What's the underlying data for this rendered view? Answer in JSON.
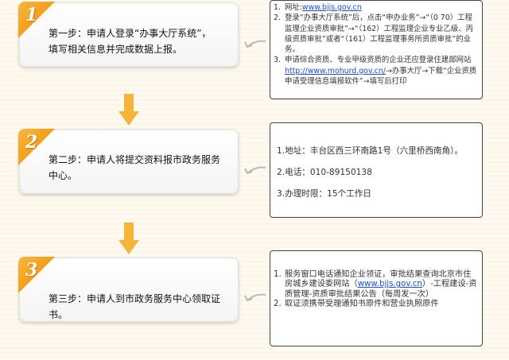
{
  "steps": [
    {
      "num": "1",
      "line1": "第一步：申请人登录“办事大厅系统”，",
      "line2": "填写相关信息并完成数据上报。"
    },
    {
      "num": "2",
      "line1": "第二步：申请人将提交资料报市政务服务",
      "line2": "中心。"
    },
    {
      "num": "3",
      "line1": "第三步：申请人到市政务服务中心领取证书。",
      "line2": ""
    }
  ],
  "info1": {
    "items": [
      {
        "n": "1.",
        "pre": "网址:",
        "link": "www.bjjs.gov.cn",
        "post": ""
      },
      {
        "n": "2.",
        "pre": "登录“办事大厅系统”后，点击“申办业务”→“（0 70）工程监理企业资质审批”→“（162）工程监理企业专业乙级、丙级资质审批”或者“（161）工程监理事务所资质审批”的业务。",
        "link": "",
        "post": ""
      },
      {
        "n": "3.",
        "pre": "申请综合资质、专业甲级资质的企业还应登录住建部网站",
        "link": "http://www.mohurd.gov.cn/",
        "post": "→办事大厅→下载“企业资质申请受理信息填报软件”→填写后打印"
      }
    ]
  },
  "info2": {
    "items": [
      {
        "n": "1.",
        "text": "地址：丰台区西三环南路1号（六里桥西南角）。"
      },
      {
        "n": "2.",
        "text": "电话：010-89150138"
      },
      {
        "n": "3.",
        "text": "办理时限：15个工作日"
      }
    ]
  },
  "info3": {
    "items": [
      {
        "n": "1.",
        "pre": "服务窗口电话通知企业领证，审批结果查询北京市住房城乡建设委网站（",
        "link": "www.bjjs.gov.cn",
        "post": "）-工程建设-资质管理-资质审批结果公告（每周发一次）"
      },
      {
        "n": "2.",
        "pre": "取证须携带受理通知书原件和营业执照原件",
        "link": "",
        "post": ""
      }
    ]
  },
  "colors": {
    "accent": "#f39a14",
    "arrow": "#f7b43a",
    "link": "#1a4ee0"
  }
}
